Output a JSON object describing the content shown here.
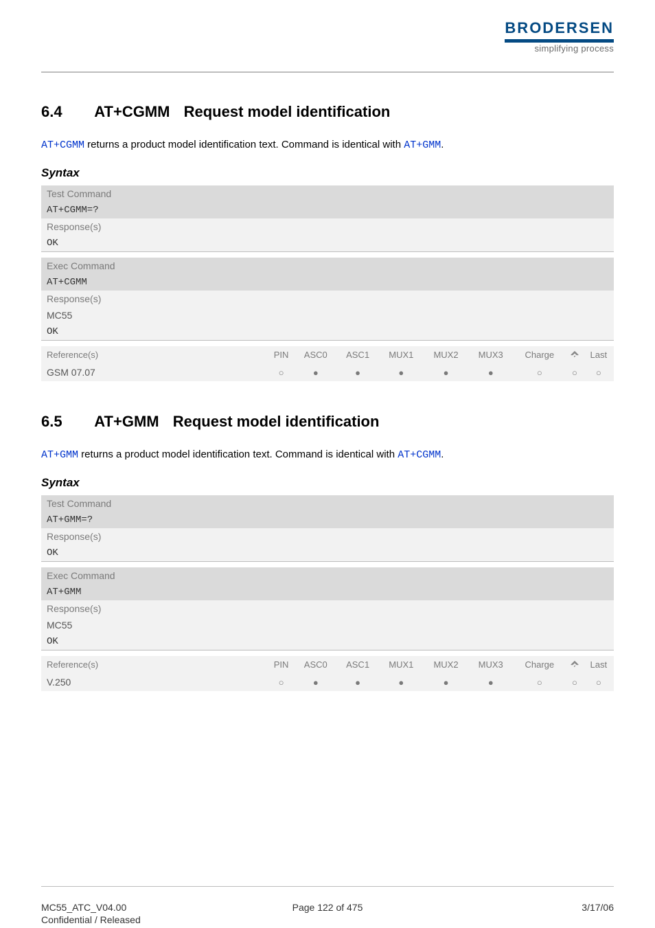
{
  "logo": {
    "name": "BRODERSEN",
    "tagline": "simplifying process"
  },
  "section64": {
    "number": "6.4",
    "cmd": "AT+CGMM",
    "title": "Request model identification",
    "intro_pre": " returns a product model identification text. Command is identical with ",
    "intro_link1": "AT+CGMM",
    "intro_link2": "AT+GMM",
    "intro_end": "."
  },
  "section65": {
    "number": "6.5",
    "cmd": "AT+GMM",
    "title": "Request model identification",
    "intro_pre": " returns a product model identification text. Command is identical with ",
    "intro_link1": "AT+GMM",
    "intro_link2": "AT+CGMM",
    "intro_end": "."
  },
  "labels": {
    "syntax": "Syntax",
    "test_command": "Test Command",
    "exec_command": "Exec Command",
    "responses": "Response(s)",
    "reference": "Reference(s)",
    "ok": "OK",
    "mc55": "MC55"
  },
  "tests": {
    "cgmm": "AT+CGMM=?",
    "gmm": "AT+GMM=?"
  },
  "execs": {
    "cgmm": "AT+CGMM",
    "gmm": "AT+GMM"
  },
  "ref_headers": [
    "PIN",
    "ASC0",
    "ASC1",
    "MUX1",
    "MUX2",
    "MUX3",
    "Charge",
    "",
    "Last"
  ],
  "ref64": {
    "name": "GSM 07.07",
    "cells": [
      "○",
      "●",
      "●",
      "●",
      "●",
      "●",
      "○",
      "○",
      "○"
    ]
  },
  "ref65": {
    "name": "V.250",
    "cells": [
      "○",
      "●",
      "●",
      "●",
      "●",
      "●",
      "○",
      "○",
      "○"
    ]
  },
  "footer": {
    "left1": "MC55_ATC_V04.00",
    "left2": "Confidential / Released",
    "mid": "Page 122 of 475",
    "right": "3/17/06"
  }
}
